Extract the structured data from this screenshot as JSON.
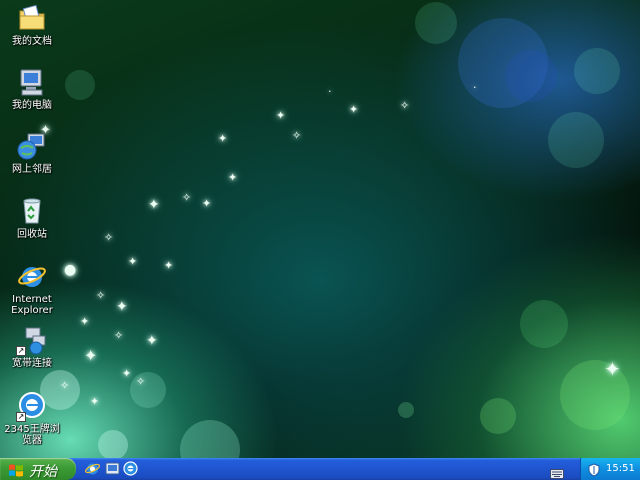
{
  "desktop": {
    "icons": [
      {
        "name": "my-documents",
        "label": "我的文档"
      },
      {
        "name": "my-computer",
        "label": "我的电脑"
      },
      {
        "name": "network-places",
        "label": "网上邻居"
      },
      {
        "name": "recycle-bin",
        "label": "回收站"
      },
      {
        "name": "internet-explorer",
        "label": "Internet Explorer"
      },
      {
        "name": "broadband-connection",
        "label": "宽带连接"
      },
      {
        "name": "browser-2345",
        "label": "2345王牌浏览器"
      }
    ]
  },
  "taskbar": {
    "start_label": "开始",
    "quick_launch": [
      "ie-icon",
      "show-desktop-icon",
      "browser-2345-icon"
    ],
    "tray": {
      "clock": "15:51"
    }
  },
  "colors": {
    "taskbar": "#245edb",
    "start_button": "#3c9b35",
    "tray": "#0f8fe0"
  }
}
